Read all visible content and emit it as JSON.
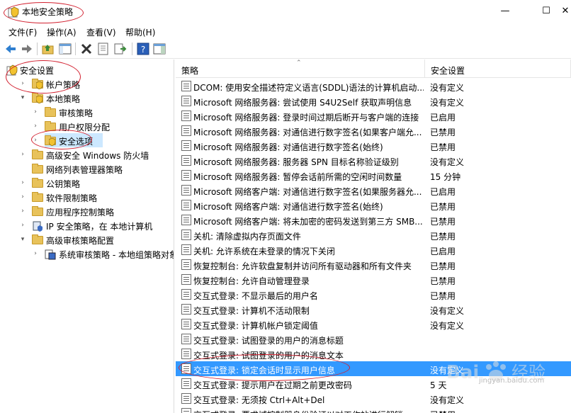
{
  "window": {
    "title": "本地安全策略",
    "min_glyph": "—",
    "max_glyph": "☐",
    "close_glyph": "✕"
  },
  "menu": [
    "文件(F)",
    "操作(A)",
    "查看(V)",
    "帮助(H)"
  ],
  "toolbar": {
    "icons": [
      "back-arrow-icon",
      "forward-arrow-icon",
      "up-folder-icon",
      "show-tree-icon",
      "delete-icon",
      "properties-icon",
      "export-list-icon",
      "help-icon",
      "show-pane-icon"
    ]
  },
  "tree": [
    {
      "label": "安全设置",
      "level": 0,
      "expanded": true,
      "icon": "security-settings-icon"
    },
    {
      "label": "帐户策略",
      "level": 1,
      "expanded": false,
      "icon": "folder-icon"
    },
    {
      "label": "本地策略",
      "level": 1,
      "expanded": true,
      "icon": "folder-icon"
    },
    {
      "label": "审核策略",
      "level": 2,
      "expanded": false,
      "icon": "folder-icon"
    },
    {
      "label": "用户权限分配",
      "level": 2,
      "expanded": false,
      "icon": "folder-icon"
    },
    {
      "label": "安全选项",
      "level": 2,
      "expanded": false,
      "icon": "folder-icon",
      "selected": true
    },
    {
      "label": "高级安全 Windows 防火墙",
      "level": 1,
      "expanded": false,
      "icon": "folder-icon"
    },
    {
      "label": "网络列表管理器策略",
      "level": 1,
      "expanded": null,
      "icon": "folder-icon"
    },
    {
      "label": "公钥策略",
      "level": 1,
      "expanded": false,
      "icon": "folder-icon"
    },
    {
      "label": "软件限制策略",
      "level": 1,
      "expanded": false,
      "icon": "folder-icon"
    },
    {
      "label": "应用程序控制策略",
      "level": 1,
      "expanded": false,
      "icon": "folder-icon"
    },
    {
      "label": "IP 安全策略，在 本地计算机",
      "level": 1,
      "expanded": false,
      "icon": "ip-security-icon"
    },
    {
      "label": "高级审核策略配置",
      "level": 1,
      "expanded": true,
      "icon": "folder-icon"
    },
    {
      "label": "系统审核策略 - 本地组策略对象",
      "level": 2,
      "expanded": false,
      "icon": "audit-policy-icon"
    }
  ],
  "list": {
    "headers": {
      "policy": "策略",
      "setting": "安全设置"
    },
    "rows": [
      {
        "name": "DCOM: 使用安全描述符定义语言(SDDL)语法的计算机启动...",
        "value": "没有定义"
      },
      {
        "name": "Microsoft 网络服务器: 尝试使用 S4U2Self 获取声明信息",
        "value": "没有定义"
      },
      {
        "name": "Microsoft 网络服务器: 登录时间过期后断开与客户端的连接",
        "value": "已启用"
      },
      {
        "name": "Microsoft 网络服务器: 对通信进行数字签名(如果客户端允...",
        "value": "已禁用"
      },
      {
        "name": "Microsoft 网络服务器: 对通信进行数字签名(始终)",
        "value": "已禁用"
      },
      {
        "name": "Microsoft 网络服务器: 服务器 SPN 目标名称验证级别",
        "value": "没有定义"
      },
      {
        "name": "Microsoft 网络服务器: 暂停会话前所需的空闲时间数量",
        "value": "15 分钟"
      },
      {
        "name": "Microsoft 网络客户端: 对通信进行数字签名(如果服务器允...",
        "value": "已启用"
      },
      {
        "name": "Microsoft 网络客户端: 对通信进行数字签名(始终)",
        "value": "已禁用"
      },
      {
        "name": "Microsoft 网络客户端: 将未加密的密码发送到第三方 SMB...",
        "value": "已禁用"
      },
      {
        "name": "关机: 清除虚拟内存页面文件",
        "value": "已禁用"
      },
      {
        "name": "关机: 允许系统在未登录的情况下关闭",
        "value": "已启用"
      },
      {
        "name": "恢复控制台: 允许软盘复制并访问所有驱动器和所有文件夹",
        "value": "已禁用"
      },
      {
        "name": "恢复控制台: 允许自动管理登录",
        "value": "已禁用"
      },
      {
        "name": "交互式登录: 不显示最后的用户名",
        "value": "已禁用"
      },
      {
        "name": "交互式登录: 计算机不活动限制",
        "value": "没有定义"
      },
      {
        "name": "交互式登录: 计算机帐户锁定阈值",
        "value": "没有定义"
      },
      {
        "name": "交互式登录: 试图登录的用户的消息标题",
        "value": ""
      },
      {
        "name": "交互式登录: 试图登录的用户的消息文本",
        "value": ""
      },
      {
        "name": "交互式登录: 锁定会话时显示用户信息",
        "value": "没有定义",
        "highlight": true
      },
      {
        "name": "交互式登录: 提示用户在过期之前更改密码",
        "value": "5 天"
      },
      {
        "name": "交互式登录: 无须按 Ctrl+Alt+Del",
        "value": "没有定义"
      },
      {
        "name": "交互式登录: 要求域控制器身份验证以对工作站进行解锁",
        "value": "已禁用"
      }
    ]
  },
  "watermark": {
    "brand": "Bai",
    "brand2": "经验",
    "url": "jingyan.baidu.com"
  },
  "colors": {
    "selection": "#3399ff",
    "tree_selection": "#cce8ff",
    "annotation": "#d2202f"
  }
}
